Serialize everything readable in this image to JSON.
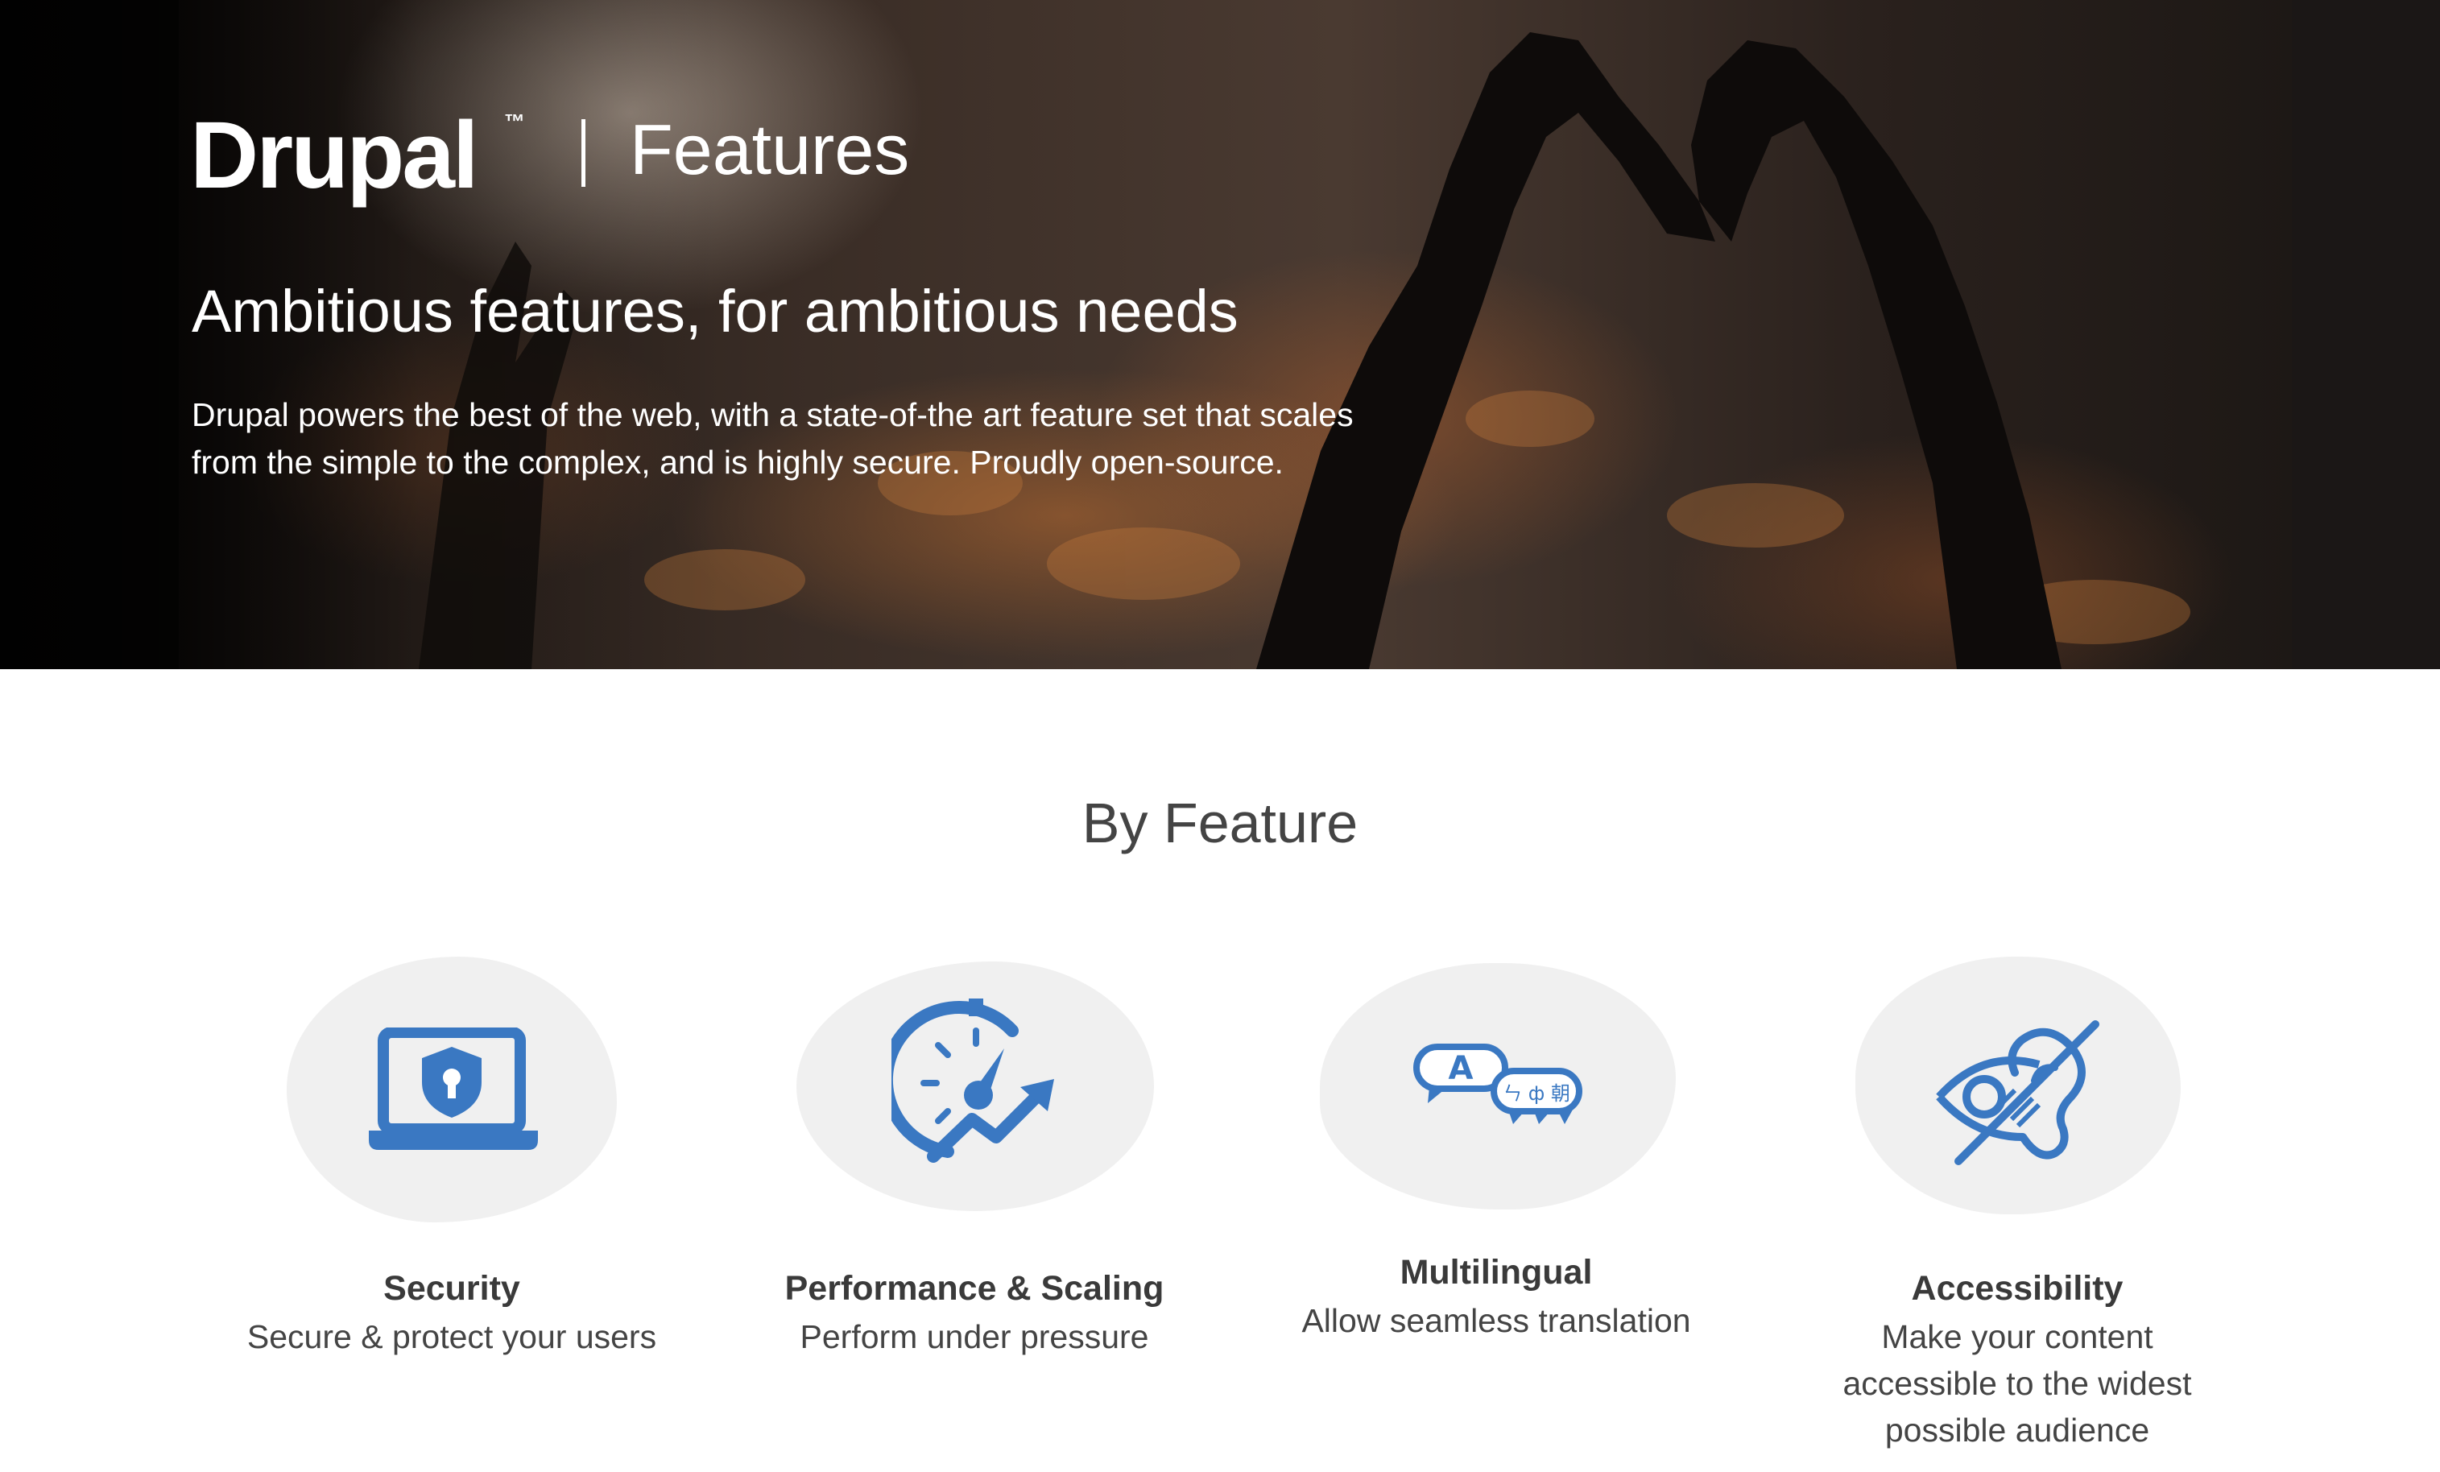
{
  "header": {
    "logo_text": "Drupal",
    "logo_tm": "™",
    "section_label": "Features"
  },
  "hero": {
    "title": "Ambitious features, for ambitious needs",
    "description": "Drupal powers the best of the web, with a state-of-the art feature set that scales from the simple to the complex, and is highly secure. Proudly open-source."
  },
  "main": {
    "section_title": "By Feature",
    "features": [
      {
        "title": "Security",
        "description": "Secure & protect your users",
        "icon": "laptop-shield-icon"
      },
      {
        "title": "Performance & Scaling",
        "description": "Perform under pressure",
        "icon": "speedometer-growth-icon"
      },
      {
        "title": "Multilingual",
        "description": "Allow seamless translation",
        "icon": "translation-bubbles-icon",
        "icon_glyph_a": "A",
        "icon_glyph_b": "ㄣ ф 朝"
      },
      {
        "title": "Accessibility",
        "description": "Make your content accessible to the widest possible audience",
        "icon": "accessibility-eye-ear-icon"
      }
    ]
  },
  "colors": {
    "icon_blue": "#3a78c2",
    "blob_gray": "#f0f0f0",
    "text_dark": "#3a3a3a"
  }
}
